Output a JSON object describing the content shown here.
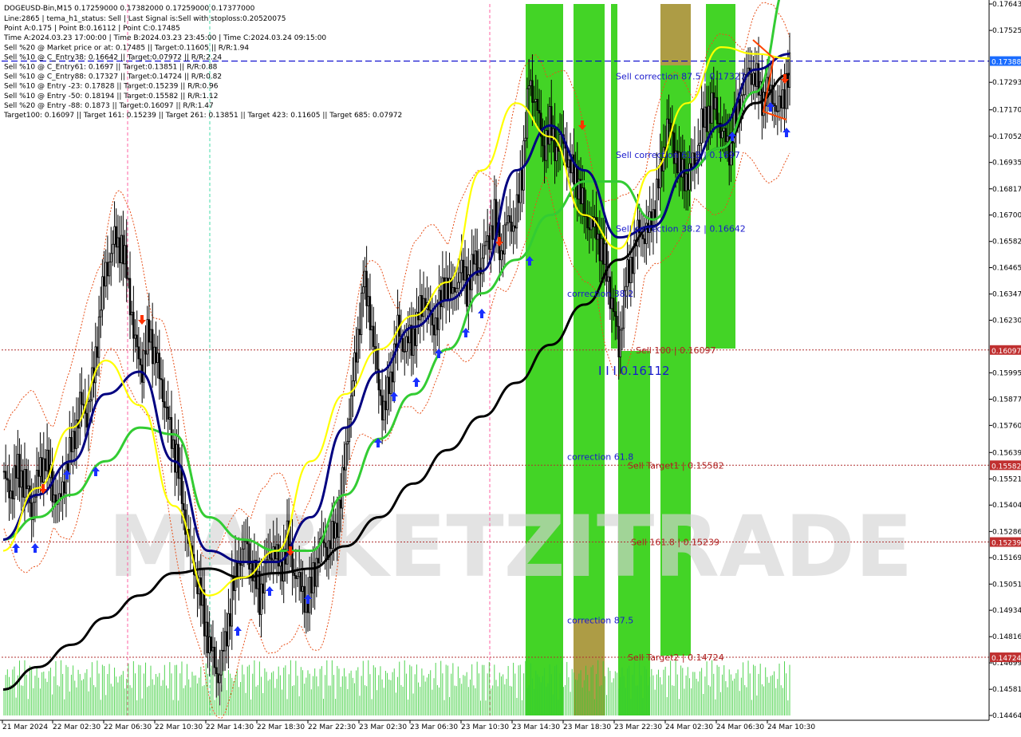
{
  "header": {
    "symbol_line": "DOGEUSD-Bin,M15  0.17259000 0.17382000 0.17259000 0.17377000",
    "info_lines": [
      "Line:2865 | tema_h1_status: Sell | Last Signal is:Sell with stoploss:0.20520075",
      "Point A:0.175 | Point B:0.16112 | Point C:0.17485",
      "Time A:2024.03.23 17:00:00 | Time B:2024.03.23 23:45:00 | Time C:2024.03.24 09:15:00",
      "Sell %20 @ Market price or at: 0.17485 || Target:0.11605 || R/R:1.94",
      "Sell %10 @ C_Entry38: 0.16642 || Target:0.07972 || R/R:2.24",
      "Sell %10 @ C_Entry61: 0.1697 || Target:0.13851 || R/R:0.88",
      "Sell %10 @ C_Entry88: 0.17327 || Target:0.14724 || R/R:0.82",
      "Sell %10 @ Entry -23: 0.17828 || Target:0.15239 || R/R:0.96",
      "Sell %10 @ Entry -50: 0.18194 || Target:0.15582 || R/R:1.12",
      "Sell %20 @ Entry -88: 0.1873 || Target:0.16097 || R/R:1.47",
      "Target100: 0.16097 || Target 161: 0.15239 || Target 261: 0.13851 || Target 423: 0.11605 || Target 685: 0.07972"
    ]
  },
  "watermark": "MARKETZITRADE",
  "colors": {
    "background": "#ffffff",
    "candle": "#000000",
    "green_zone": "#22cc00",
    "orange_zone": "#d08a50",
    "ma_black": "#000000",
    "ma_green": "#33cc33",
    "ma_navy": "#000080",
    "ma_yellow": "#ffff00",
    "envelope": "#e8501a",
    "level_line": "#b03030",
    "current_line": "#0000cc",
    "annotation_blue": "#1a1acc",
    "annotation_red": "#b02020",
    "arrow_blue": "#1a30ff",
    "arrow_red": "#ff3300",
    "volume": "#33cc33"
  },
  "chart_data": {
    "type": "candlestick",
    "title": "DOGEUSD-Bin,M15",
    "ylim": [
      0.14464,
      0.17643
    ],
    "y_ticks": [
      "0.17643",
      "0.17525",
      "0.17293",
      "0.17170",
      "0.17052",
      "0.16935",
      "0.16817",
      "0.16700",
      "0.16582",
      "0.16465",
      "0.16347",
      "0.16230",
      "0.15995",
      "0.15877",
      "0.15760",
      "0.15639",
      "0.15521",
      "0.15404",
      "0.15286",
      "0.15169",
      "0.15051",
      "0.14934",
      "0.14816",
      "0.14699",
      "0.14581",
      "0.14464"
    ],
    "x_ticks": [
      "21 Mar 2024",
      "22 Mar 02:30",
      "22 Mar 06:30",
      "22 Mar 10:30",
      "22 Mar 14:30",
      "22 Mar 18:30",
      "22 Mar 22:30",
      "23 Mar 02:30",
      "23 Mar 06:30",
      "23 Mar 10:30",
      "23 Mar 14:30",
      "23 Mar 18:30",
      "23 Mar 22:30",
      "24 Mar 02:30",
      "24 Mar 06:30",
      "24 Mar 10:30"
    ],
    "price_path": [
      0.1552,
      0.1545,
      0.1558,
      0.155,
      0.1538,
      0.1556,
      0.156,
      0.1548,
      0.1541,
      0.1555,
      0.157,
      0.1585,
      0.158,
      0.16,
      0.163,
      0.1648,
      0.166,
      0.1655,
      0.164,
      0.1612,
      0.16,
      0.162,
      0.1605,
      0.159,
      0.1575,
      0.156,
      0.1538,
      0.152,
      0.1505,
      0.149,
      0.1475,
      0.1462,
      0.148,
      0.15,
      0.1515,
      0.1525,
      0.151,
      0.15,
      0.1515,
      0.152,
      0.1512,
      0.1525,
      0.151,
      0.1505,
      0.1495,
      0.1512,
      0.1525,
      0.152,
      0.153,
      0.155,
      0.158,
      0.161,
      0.164,
      0.1625,
      0.16,
      0.158,
      0.1598,
      0.162,
      0.161,
      0.1615,
      0.1625,
      0.1632,
      0.162,
      0.1628,
      0.164,
      0.1635,
      0.1645,
      0.1638,
      0.165,
      0.1645,
      0.166,
      0.1668,
      0.1652,
      0.167,
      0.1665,
      0.169,
      0.173,
      0.172,
      0.17,
      0.171,
      0.1698,
      0.1705,
      0.169,
      0.1685,
      0.1672,
      0.1665,
      0.166,
      0.165,
      0.163,
      0.1612,
      0.164,
      0.165,
      0.1665,
      0.166,
      0.167,
      0.169,
      0.171,
      0.17,
      0.169,
      0.1685,
      0.1695,
      0.171,
      0.1715,
      0.172,
      0.1705,
      0.17,
      0.1715,
      0.1725,
      0.1735,
      0.173,
      0.172,
      0.1728,
      0.1715,
      0.1725,
      0.1737
    ],
    "series": [
      {
        "key": "ma_black",
        "values": [
          0.1458,
          0.1468,
          0.1478,
          0.149,
          0.15,
          0.151,
          0.1512,
          0.1508,
          0.151,
          0.1512,
          0.1522,
          0.1535,
          0.155,
          0.1565,
          0.158,
          0.1595,
          0.1612,
          0.163,
          0.165,
          0.1665,
          0.169,
          0.17,
          0.172,
          0.1733
        ]
      },
      {
        "key": "ma_green",
        "values": [
          0.1525,
          0.1535,
          0.1545,
          0.156,
          0.1575,
          0.1572,
          0.1535,
          0.1525,
          0.152,
          0.152,
          0.1545,
          0.157,
          0.159,
          0.161,
          0.1635,
          0.165,
          0.167,
          0.1685,
          0.1685,
          0.1668,
          0.169,
          0.17,
          0.1725,
          0.1775
        ]
      },
      {
        "key": "ma_navy",
        "values": [
          0.1525,
          0.1545,
          0.156,
          0.159,
          0.16,
          0.156,
          0.152,
          0.1515,
          0.1515,
          0.1535,
          0.1575,
          0.16,
          0.162,
          0.1632,
          0.1645,
          0.169,
          0.171,
          0.169,
          0.166,
          0.1665,
          0.169,
          0.171,
          0.1735,
          0.1742
        ]
      },
      {
        "key": "ma_yellow",
        "values": [
          0.152,
          0.1548,
          0.1575,
          0.1605,
          0.1585,
          0.154,
          0.15,
          0.1508,
          0.152,
          0.156,
          0.159,
          0.161,
          0.1625,
          0.164,
          0.169,
          0.172,
          0.1705,
          0.167,
          0.1655,
          0.169,
          0.172,
          0.1745,
          0.1742,
          0.174
        ]
      }
    ],
    "levels": [
      {
        "label": "0.17388",
        "value": 0.17388,
        "kind": "current"
      },
      {
        "label": "0.16097",
        "value": 0.16097,
        "kind": "target"
      },
      {
        "label": "0.15582",
        "value": 0.15582,
        "kind": "target"
      },
      {
        "label": "0.15239",
        "value": 0.15239,
        "kind": "target"
      },
      {
        "label": "0.14724",
        "value": 0.14724,
        "kind": "target"
      }
    ],
    "annotations": [
      {
        "text": "Sell correction 87.5 | 0.17327",
        "color": "blue",
        "price": 0.1732,
        "col": "right"
      },
      {
        "text": "Sell correction 61.8 | 0.1697",
        "color": "blue",
        "price": 0.1697,
        "col": "right"
      },
      {
        "text": "Sell correction 38.2 | 0.16642",
        "color": "blue",
        "price": 0.1664,
        "col": "right"
      },
      {
        "text": "correction 38.2",
        "color": "blue",
        "price": 0.1635,
        "col": "left"
      },
      {
        "text": "correction 61.8",
        "color": "blue",
        "price": 0.1562,
        "col": "left"
      },
      {
        "text": "correction 87.5",
        "color": "blue",
        "price": 0.1489,
        "col": "left"
      },
      {
        "text": "Sell 100 | 0.16097",
        "color": "red",
        "price": 0.16097,
        "col": "right"
      },
      {
        "text": "I I I 0.16112",
        "color": "blue",
        "price": 0.16,
        "col": "mid"
      },
      {
        "text": "Sell Target1 | 0.15582",
        "color": "red",
        "price": 0.15582,
        "col": "right"
      },
      {
        "text": "Sell 161.8 | 0.15239",
        "color": "red",
        "price": 0.15239,
        "col": "right"
      },
      {
        "text": "Sell Target2 | 0.14724",
        "color": "red",
        "price": 0.14724,
        "col": "right"
      }
    ]
  }
}
